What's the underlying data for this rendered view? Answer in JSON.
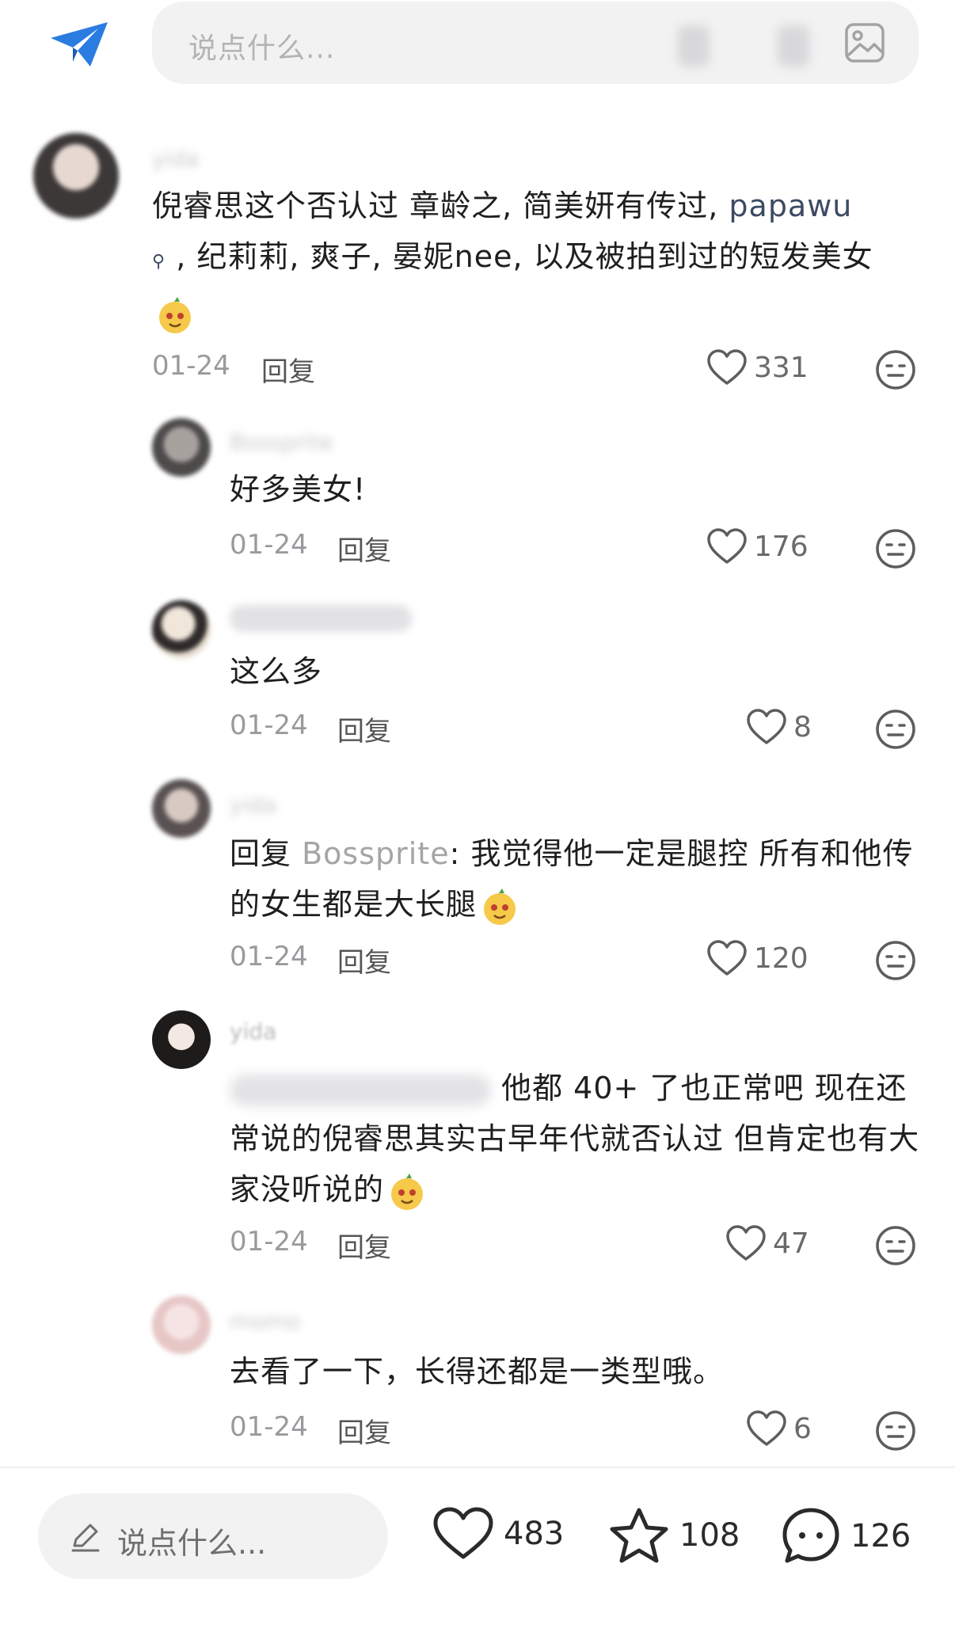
{
  "top_bar": {
    "placeholder": "说点什么..."
  },
  "comments": [
    {
      "text_before": "倪睿思这个否认过  章龄之, 简美妍有传过, ",
      "mention": "papawu",
      "text_mid": " , 纪莉莉, 爽子, 晏妮nee, 以及被拍到过的短发美女",
      "date": "01-24",
      "reply_label": "回复",
      "likes": "331"
    },
    {
      "text": "好多美女!",
      "date": "01-24",
      "reply_label": "回复",
      "likes": "176"
    },
    {
      "text": "这么多",
      "date": "01-24",
      "reply_label": "回复",
      "likes": "8"
    },
    {
      "reply_prefix": "回复 ",
      "reply_to": "Bossprite",
      "text": ": 我觉得他一定是腿控 所有和他传的女生都是大长腿",
      "date": "01-24",
      "reply_label": "回复",
      "likes": "120"
    },
    {
      "text": "他都 40+ 了也正常吧  现在还常说的倪睿思其实古早年代就否认过 但肯定也有大家没听说的",
      "date": "01-24",
      "reply_label": "回复",
      "likes": "47"
    },
    {
      "text": "去看了一下，长得还都是一类型哦。",
      "date": "01-24",
      "reply_label": "回复",
      "likes": "6"
    }
  ],
  "bottom_bar": {
    "placeholder": "说点什么...",
    "likes": "483",
    "favorites": "108",
    "comments": "126"
  },
  "icons": {
    "send": "paper-plane-icon",
    "image": "image-icon",
    "like": "heart-icon",
    "dislike": "neutral-face-icon",
    "favorite": "star-icon",
    "comment": "chat-bubble-icon",
    "edit": "pen-icon",
    "emoji": "smiling-face-emoji"
  },
  "colors": {
    "accent_blue": "#2a7ce0",
    "mention": "#3d4a63",
    "muted": "#9a9a9e"
  }
}
